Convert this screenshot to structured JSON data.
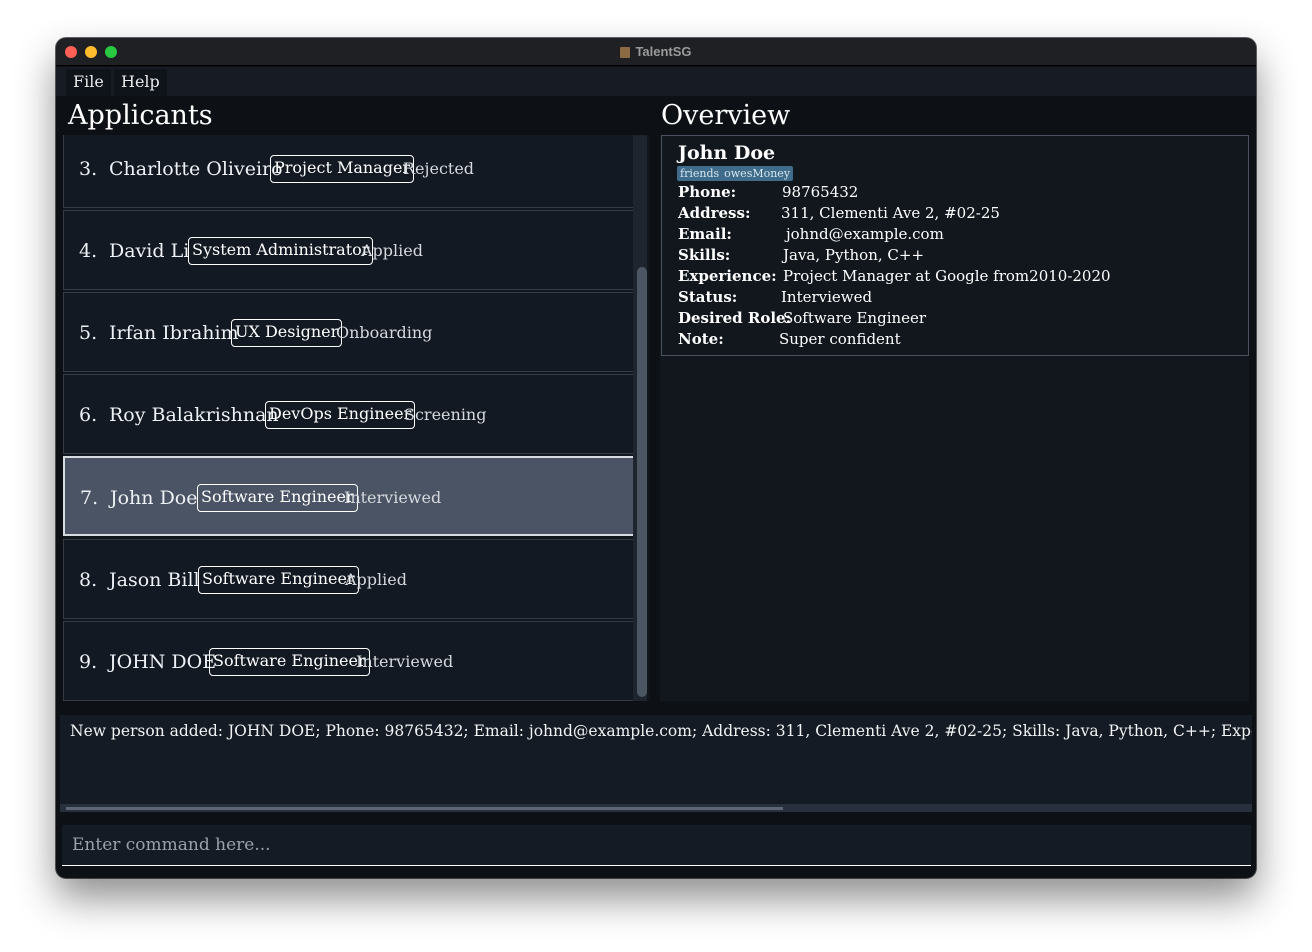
{
  "window": {
    "title": "TalentSG",
    "icon": "person-icon"
  },
  "menu": {
    "file_label": "File",
    "help_label": "Help"
  },
  "applicants": {
    "heading": "Applicants",
    "items": [
      {
        "index": "3.",
        "name": "Charlotte Oliveiro",
        "role": "Project Manager",
        "status": "Rejected"
      },
      {
        "index": "4.",
        "name": "David Li",
        "role": "System Administrator",
        "status": "Applied"
      },
      {
        "index": "5.",
        "name": "Irfan Ibrahim",
        "role": "UX Designer",
        "status": "Onboarding"
      },
      {
        "index": "6.",
        "name": "Roy Balakrishnan",
        "role": "DevOps Engineer",
        "status": "Screening"
      },
      {
        "index": "7.",
        "name": "John Doe",
        "role": "Software Engineer",
        "status": "Interviewed",
        "selected": true
      },
      {
        "index": "8.",
        "name": "Jason Bill",
        "role": "Software Engineer",
        "status": "Applied"
      },
      {
        "index": "9.",
        "name": "JOHN DOE",
        "role": "Software Engineer",
        "status": "Interviewed"
      }
    ]
  },
  "overview": {
    "heading": "Overview",
    "name": "John Doe",
    "tags": [
      "friends",
      "owesMoney"
    ],
    "fields": {
      "phone_label": "Phone:",
      "phone_value": "98765432",
      "address_label": "Address:",
      "address_value": "311, Clementi Ave 2, #02-25",
      "email_label": "Email:",
      "email_value": "johnd@example.com",
      "skills_label": "Skills:",
      "skills_value": "Java, Python, C++",
      "experience_label": "Experience:",
      "experience_value": "Project Manager at Google from2010-2020",
      "status_label": "Status:",
      "status_value": "Interviewed",
      "desired_role_label": "Desired Role:",
      "desired_role_value": "Software Engineer",
      "note_label": "Note:",
      "note_value": "Super confident"
    }
  },
  "result": {
    "message": "New person added: JOHN DOE; Phone: 98765432; Email: johnd@example.com; Address: 311, Clementi Ave 2, #02-25; Skills: Java, Python, C++; Experience: Project M"
  },
  "command": {
    "placeholder": "Enter command here..."
  },
  "colors": {
    "background": "#0d1015",
    "panel": "#12171e",
    "selected_card": "#4a5464",
    "tag": "#3e6c8a"
  }
}
